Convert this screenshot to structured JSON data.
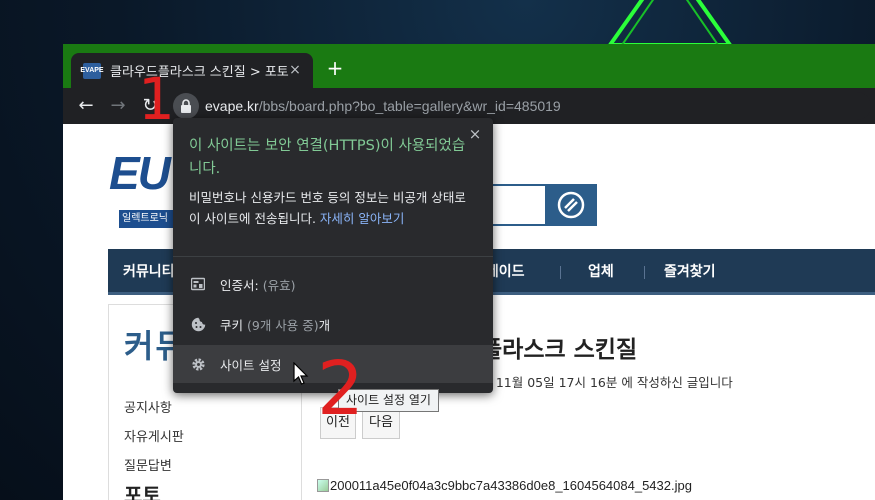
{
  "browser": {
    "tab": {
      "favicon_text": "EVAPE",
      "title": "클라우드플라스크 스킨질 > 포토",
      "close": "×"
    },
    "new_tab": "+",
    "nav": {
      "back": "←",
      "forward": "→",
      "reload": "↻"
    },
    "url": {
      "host": "evape.kr",
      "path": "/bbs/board.php?bo_table=gallery&wr_id=485019"
    }
  },
  "page": {
    "logo": "EU",
    "logo_sub": "일렉트로닉",
    "nav_items": [
      "커뮤니티",
      "트레이드",
      "업체",
      "즐겨찾기"
    ],
    "sidebar": {
      "title": "커뮤",
      "items": [
        "공지사항",
        "자유게시판",
        "질문답변"
      ],
      "current": "포토"
    },
    "post": {
      "title": "플라스크 스킨질",
      "meta": "233.72) 님이 2020년 11월 05일 17시 16분 에 작성하신 글입니다",
      "prev": "이전",
      "next": "다음",
      "image_alt": "200011a45e0f04a3c9bbc7a43386d0e8_1604564084_5432.jpg"
    }
  },
  "popup": {
    "close": "×",
    "heading": "이 사이트는 보안 연결(HTTPS)이 사용되었습니다.",
    "description": "비밀번호나 신용카드 번호 등의 정보는 비공개 상태로 이 사이트에 전송됩니다.",
    "learn_more": "자세히 알아보기",
    "rows": {
      "certificate": {
        "label": "인증서:",
        "detail": "(유효)"
      },
      "cookies": {
        "label": "쿠키",
        "detail": "(9개 사용 중)",
        "suffix": "개"
      },
      "site_settings": {
        "label": "사이트 설정"
      }
    }
  },
  "tooltip": "사이트 설정 열기",
  "annotations": {
    "first": "1",
    "second": "2"
  },
  "colors": {
    "tab_bar": "#1a7a12",
    "toolbar": "#202124",
    "popup_bg": "#292a2d",
    "secure_green": "#81c995",
    "link_blue": "#8ab4f8",
    "site_navy": "#1f3a55",
    "annotation_red": "#e02020"
  }
}
